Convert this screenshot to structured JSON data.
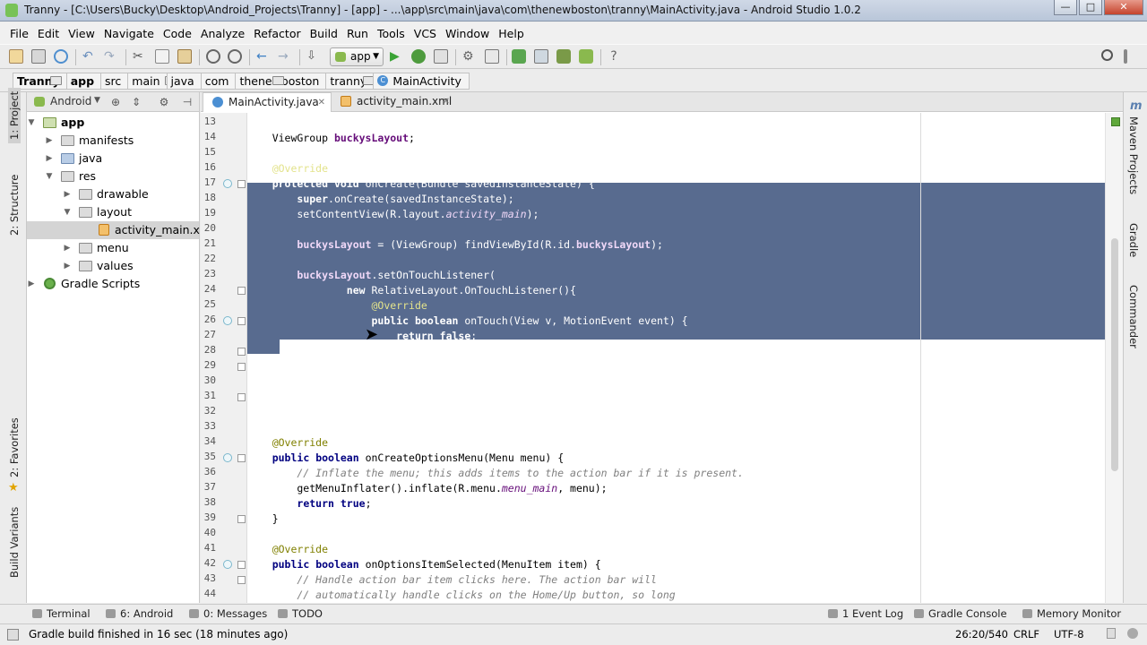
{
  "window": {
    "title": "Tranny - [C:\\Users\\Bucky\\Desktop\\Android_Projects\\Tranny] - [app] - ...\\app\\src\\main\\java\\com\\thenewboston\\tranny\\MainActivity.java - Android Studio 1.0.2",
    "minimize": "—",
    "maximize": "□",
    "close": "✕"
  },
  "menu": [
    "File",
    "Edit",
    "View",
    "Navigate",
    "Code",
    "Analyze",
    "Refactor",
    "Build",
    "Run",
    "Tools",
    "VCS",
    "Window",
    "Help"
  ],
  "toolbar": {
    "run_config": "app"
  },
  "breadcrumbs": [
    "Tranny",
    "app",
    "src",
    "main",
    "java",
    "com",
    "thenewboston",
    "tranny",
    "MainActivity"
  ],
  "left_tabs": {
    "project": "1: Project",
    "structure": "2: Structure",
    "favorites": "2: Favorites",
    "build_variants": "Build Variants"
  },
  "right_tabs": {
    "maven": "Maven Projects",
    "gradle": "Gradle",
    "commander": "Commander"
  },
  "project_panel": {
    "view": "Android",
    "tree": [
      {
        "label": "app",
        "level": 0,
        "expanded": true,
        "bold": true,
        "icon": "app-folder"
      },
      {
        "label": "manifests",
        "level": 1,
        "expanded": false,
        "icon": "folder"
      },
      {
        "label": "java",
        "level": 1,
        "expanded": false,
        "icon": "folder"
      },
      {
        "label": "res",
        "level": 1,
        "expanded": true,
        "icon": "folder"
      },
      {
        "label": "drawable",
        "level": 2,
        "expanded": false,
        "icon": "folder"
      },
      {
        "label": "layout",
        "level": 2,
        "expanded": true,
        "icon": "folder"
      },
      {
        "label": "activity_main.xml",
        "level": 3,
        "selected": true,
        "icon": "xml-file"
      },
      {
        "label": "menu",
        "level": 2,
        "expanded": false,
        "icon": "folder"
      },
      {
        "label": "values",
        "level": 2,
        "expanded": false,
        "icon": "folder"
      },
      {
        "label": "Gradle Scripts",
        "level": 0,
        "expanded": false,
        "icon": "gradle"
      }
    ]
  },
  "editor_tabs": [
    {
      "label": "MainActivity.java",
      "active": true
    },
    {
      "label": "activity_main.xml",
      "active": false
    }
  ],
  "code": {
    "lines": [
      {
        "n": "13",
        "text": ""
      },
      {
        "n": "14",
        "text": "    ViewGroup buckysLayout;"
      },
      {
        "n": "15",
        "text": ""
      },
      {
        "n": "16",
        "text": "    @Override"
      },
      {
        "n": "17",
        "text": "    protected void onCreate(Bundle savedInstanceState) {"
      },
      {
        "n": "18",
        "text": "        super.onCreate(savedInstanceState);"
      },
      {
        "n": "19",
        "text": "        setContentView(R.layout.activity_main);"
      },
      {
        "n": "20",
        "text": ""
      },
      {
        "n": "21",
        "text": "        buckysLayout = (ViewGroup) findViewById(R.id.buckysLayout);"
      },
      {
        "n": "22",
        "text": ""
      },
      {
        "n": "23",
        "text": "        buckysLayout.setOnTouchListener("
      },
      {
        "n": "24",
        "text": "                new RelativeLayout.OnTouchListener(){"
      },
      {
        "n": "25",
        "text": "                    @Override"
      },
      {
        "n": "26",
        "text": "                    public boolean onTouch(View v, MotionEvent event) {"
      },
      {
        "n": "27",
        "text": "                        return false;"
      },
      {
        "n": "28",
        "text": "                    }"
      },
      {
        "n": "29",
        "text": "                }"
      },
      {
        "n": "30",
        "text": "        );"
      },
      {
        "n": "31",
        "text": "    }"
      },
      {
        "n": "32",
        "text": ""
      },
      {
        "n": "33",
        "text": ""
      },
      {
        "n": "34",
        "text": "    @Override"
      },
      {
        "n": "35",
        "text": "    public boolean onCreateOptionsMenu(Menu menu) {"
      },
      {
        "n": "36",
        "text": "        // Inflate the menu; this adds items to the action bar if it is present."
      },
      {
        "n": "37",
        "text": "        getMenuInflater().inflate(R.menu.menu_main, menu);"
      },
      {
        "n": "38",
        "text": "        return true;"
      },
      {
        "n": "39",
        "text": "    }"
      },
      {
        "n": "40",
        "text": ""
      },
      {
        "n": "41",
        "text": "    @Override"
      },
      {
        "n": "42",
        "text": "    public boolean onOptionsItemSelected(MenuItem item) {"
      },
      {
        "n": "43",
        "text": "        // Handle action bar item clicks here. The action bar will"
      },
      {
        "n": "44",
        "text": "        // automatically handle clicks on the Home/Up button, so long"
      }
    ],
    "selected_lines": [
      "16",
      "31"
    ]
  },
  "bottom_tabs": {
    "terminal": "Terminal",
    "android": "6: Android",
    "messages": "0: Messages",
    "todo": "TODO",
    "event_log": "1 Event Log",
    "gradle_console": "Gradle Console",
    "memory_monitor": "Memory Monitor"
  },
  "status": {
    "message": "Gradle build finished in 16 sec (18 minutes ago)",
    "position": "26:20/540",
    "line_sep": "CRLF",
    "encoding": "UTF-8"
  },
  "colors": {
    "selection": "#586b8f",
    "keyword": "#000080",
    "annotation": "#808000",
    "comment": "#808080",
    "field": "#660e7a"
  }
}
